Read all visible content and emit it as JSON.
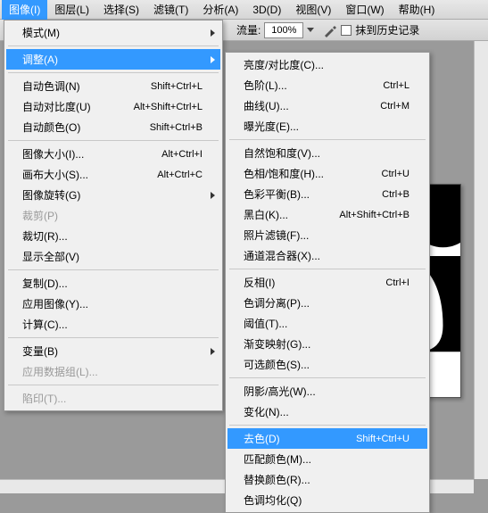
{
  "menubar": {
    "items": [
      "图像(I)",
      "图层(L)",
      "选择(S)",
      "滤镜(T)",
      "分析(A)",
      "3D(D)",
      "视图(V)",
      "窗口(W)",
      "帮助(H)"
    ]
  },
  "toolbar": {
    "flow_label": "流量:",
    "flow_value": "100%",
    "history_label": "抹到历史记录"
  },
  "menu1": [
    {
      "label": "模式(M)",
      "sub": true
    },
    {
      "sep": true
    },
    {
      "label": "调整(A)",
      "sub": true,
      "hl": true
    },
    {
      "sep": true
    },
    {
      "label": "自动色调(N)",
      "shortcut": "Shift+Ctrl+L"
    },
    {
      "label": "自动对比度(U)",
      "shortcut": "Alt+Shift+Ctrl+L"
    },
    {
      "label": "自动颜色(O)",
      "shortcut": "Shift+Ctrl+B"
    },
    {
      "sep": true
    },
    {
      "label": "图像大小(I)...",
      "shortcut": "Alt+Ctrl+I"
    },
    {
      "label": "画布大小(S)...",
      "shortcut": "Alt+Ctrl+C"
    },
    {
      "label": "图像旋转(G)",
      "sub": true
    },
    {
      "label": "裁剪(P)",
      "disabled": true
    },
    {
      "label": "裁切(R)..."
    },
    {
      "label": "显示全部(V)"
    },
    {
      "sep": true
    },
    {
      "label": "复制(D)..."
    },
    {
      "label": "应用图像(Y)..."
    },
    {
      "label": "计算(C)..."
    },
    {
      "sep": true
    },
    {
      "label": "变量(B)",
      "sub": true
    },
    {
      "label": "应用数据组(L)...",
      "disabled": true
    },
    {
      "sep": true
    },
    {
      "label": "陷印(T)...",
      "disabled": true
    }
  ],
  "menu2": [
    {
      "label": "亮度/对比度(C)..."
    },
    {
      "label": "色阶(L)...",
      "shortcut": "Ctrl+L"
    },
    {
      "label": "曲线(U)...",
      "shortcut": "Ctrl+M"
    },
    {
      "label": "曝光度(E)..."
    },
    {
      "sep": true
    },
    {
      "label": "自然饱和度(V)..."
    },
    {
      "label": "色相/饱和度(H)...",
      "shortcut": "Ctrl+U"
    },
    {
      "label": "色彩平衡(B)...",
      "shortcut": "Ctrl+B"
    },
    {
      "label": "黑白(K)...",
      "shortcut": "Alt+Shift+Ctrl+B"
    },
    {
      "label": "照片滤镜(F)..."
    },
    {
      "label": "通道混合器(X)..."
    },
    {
      "sep": true
    },
    {
      "label": "反相(I)",
      "shortcut": "Ctrl+I"
    },
    {
      "label": "色调分离(P)..."
    },
    {
      "label": "阈值(T)..."
    },
    {
      "label": "渐变映射(G)..."
    },
    {
      "label": "可选颜色(S)..."
    },
    {
      "sep": true
    },
    {
      "label": "阴影/高光(W)..."
    },
    {
      "label": "变化(N)..."
    },
    {
      "sep": true
    },
    {
      "label": "去色(D)",
      "shortcut": "Shift+Ctrl+U",
      "hl": true
    },
    {
      "label": "匹配颜色(M)..."
    },
    {
      "label": "替换颜色(R)..."
    },
    {
      "label": "色调均化(Q)"
    }
  ]
}
